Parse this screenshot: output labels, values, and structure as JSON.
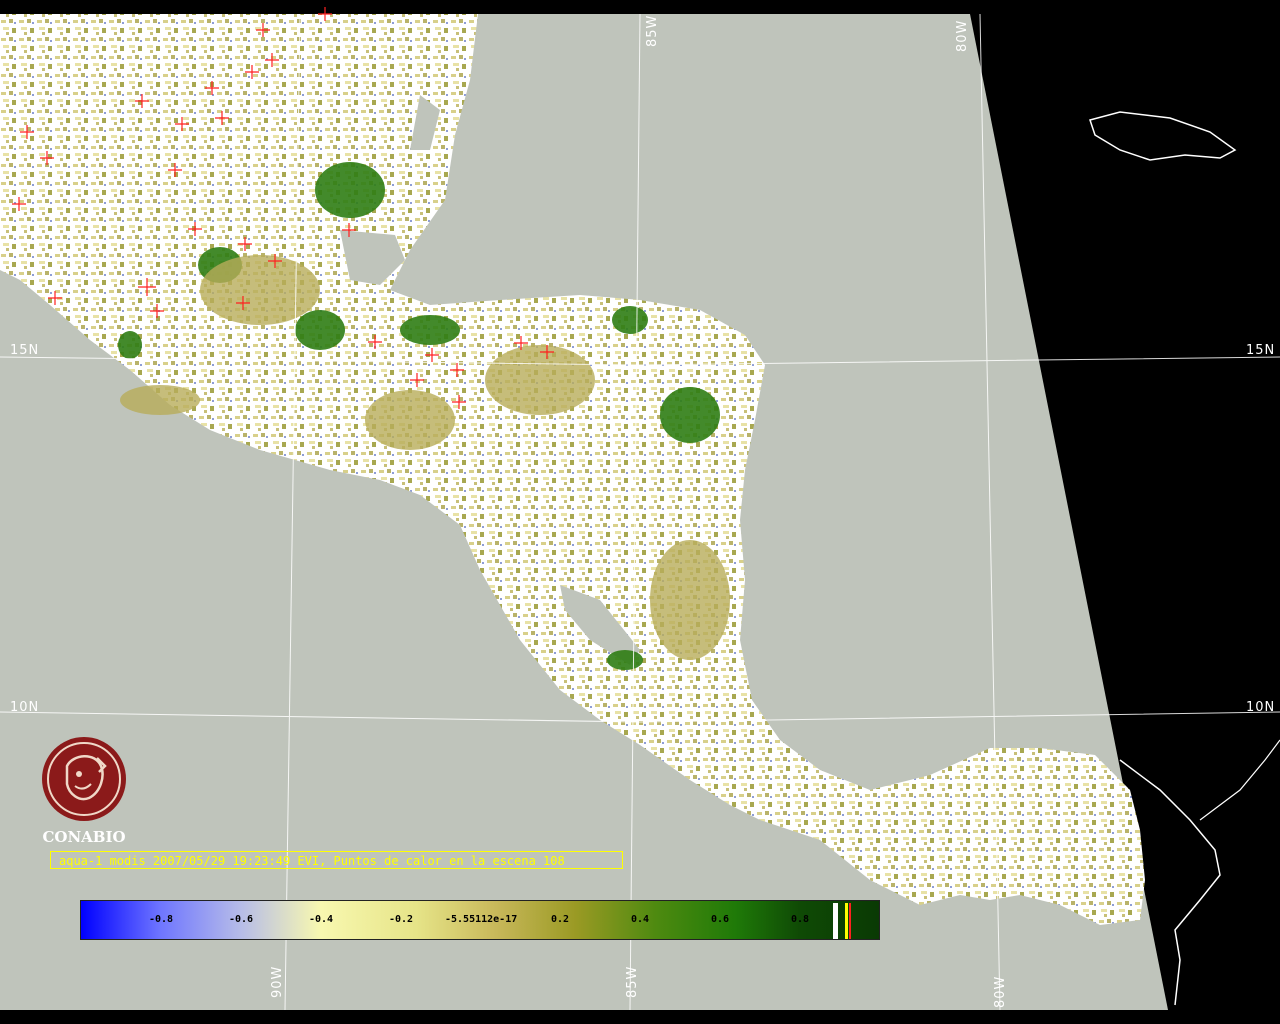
{
  "grid_labels": {
    "lat_15n": "15N",
    "lat_10n": "10N",
    "lon_85w": "85W",
    "lon_80w": "80W",
    "lon_90w": "90W"
  },
  "logo": {
    "name": "CONABIO",
    "icon": "conabio-macaw-seal-icon"
  },
  "caption": "aqua-1 modis 2007/05/29 19:23:49 EVI, Puntos de calor en la escena 108",
  "legend": {
    "ticks": [
      "-0.8",
      "-0.6",
      "-0.4",
      "-0.2",
      "-5.55112e-17",
      "0.2",
      "0.4",
      "0.6",
      "0.8"
    ]
  },
  "colors": {
    "ocean": "#bfc4bb",
    "land": "#ffffff",
    "background": "#000000",
    "hotspot": "#ff2020",
    "caption": "#ffff00",
    "logo": "#8b1a1a"
  }
}
